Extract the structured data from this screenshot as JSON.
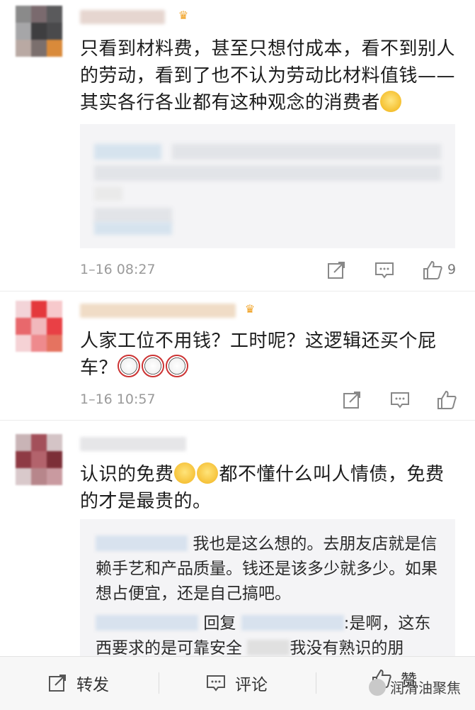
{
  "comments": [
    {
      "text": "只看到材料费，甚至只想付成本，看不到别人的劳动，看到了也不认为劳动比材料值钱——其实各行各业都有这种观念的消费者",
      "emoji": "angry-face-emoji",
      "time": "1–16 08:27",
      "likes": "9"
    },
    {
      "text": "人家工位不用钱？工时呢？这逻辑还买个屁车？",
      "emoji": "panda-face-emoji",
      "time": "1–16 10:57",
      "likes": ""
    },
    {
      "text_part1": "认识的免费",
      "text_part2": "都不懂什么叫人情债，免费的才是最贵的。",
      "emoji": "laughing-crying-emoji"
    }
  ],
  "replies": [
    {
      "text": "我也是这么想的。去朋友店就是信赖手艺和产品质量。钱还是该多少就多少。如果想占便宜，还是自己搞吧。"
    },
    {
      "reply_word": "回复",
      "text": ":是啊，这东西要求的是可靠安全",
      "text_tail": "我没有熟识的朋"
    }
  ],
  "bottom_bar": {
    "repost_label": "转发",
    "comment_label": "评论",
    "like_label": "赞"
  },
  "watermark": "润滑油聚焦",
  "colors": {
    "accent_crown": "#f0a020",
    "meta_gray": "#9a9a9a",
    "quote_bg": "#f4f4f6"
  }
}
